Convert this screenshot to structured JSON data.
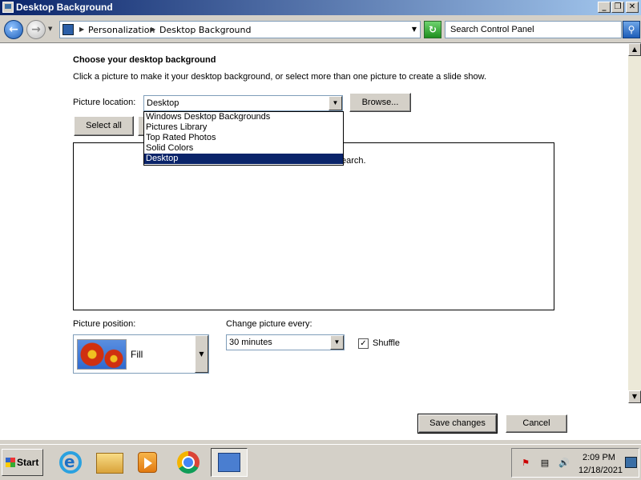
{
  "window": {
    "title": "Desktop Background"
  },
  "address": {
    "crumbs": [
      "Personalization",
      "Desktop Background"
    ],
    "search_placeholder": "Search Control Panel"
  },
  "main": {
    "heading": "Choose your desktop background",
    "instructions": "Click a picture to make it your desktop background, or select more than one picture to create a slide show.",
    "picture_location_label": "Picture location:",
    "picture_location_value": "Desktop",
    "browse_label": "Browse...",
    "select_all_label": "Select all",
    "location_options": [
      "Windows Desktop Backgrounds",
      "Pictures Library",
      "Top Rated Photos",
      "Solid Colors",
      "Desktop"
    ],
    "selected_option_index": 4,
    "area_message_fragment": "earch.",
    "picture_position_label": "Picture position:",
    "picture_position_value": "Fill",
    "change_every_label": "Change picture every:",
    "change_every_value": "30 minutes",
    "shuffle_label": "Shuffle",
    "shuffle_checked": true,
    "save_label": "Save changes",
    "cancel_label": "Cancel"
  },
  "taskbar": {
    "start_label": "Start",
    "icons": [
      "internet-explorer-icon",
      "windows-explorer-icon",
      "media-player-icon",
      "chrome-icon",
      "control-panel-icon"
    ],
    "clock_time": "2:09 PM",
    "clock_date": "12/18/2021"
  },
  "colors": {
    "title_gradient_start": "#0a246a",
    "title_gradient_end": "#a6caf0",
    "selection": "#0a246a",
    "window_face": "#d4d0c8"
  }
}
